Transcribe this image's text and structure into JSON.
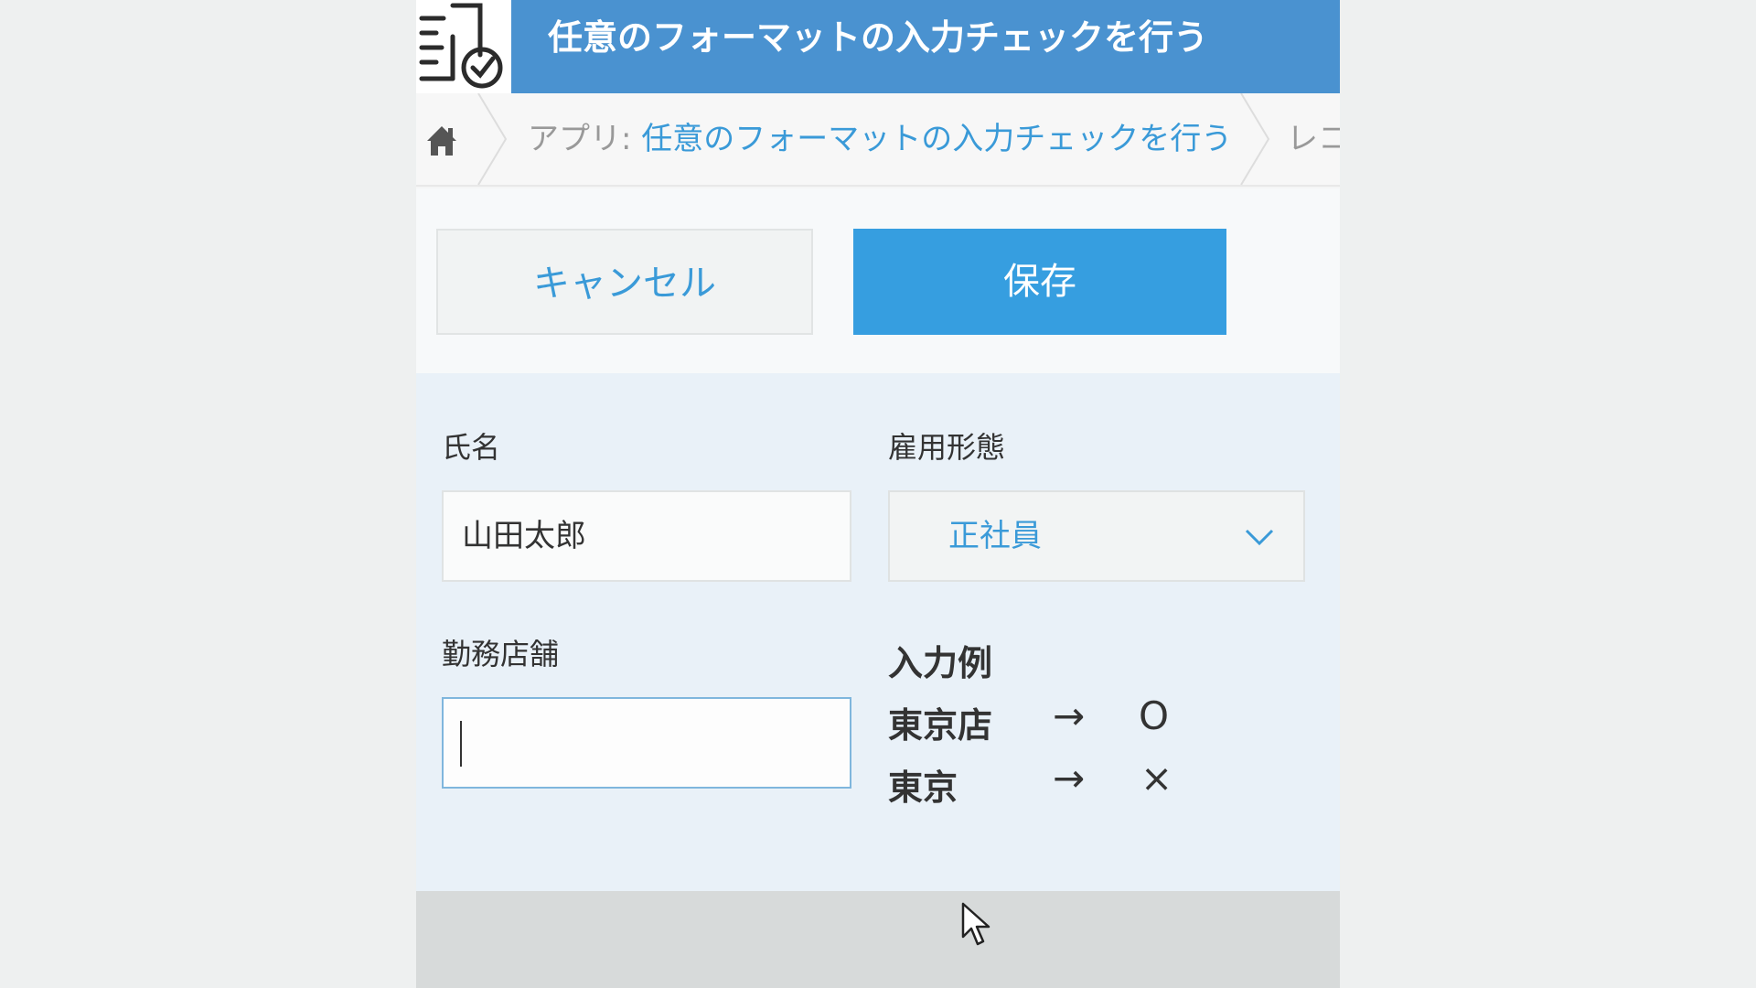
{
  "header": {
    "title": "任意のフォーマットの入力チェックを行う",
    "icon": "form-check-icon"
  },
  "breadcrumb": {
    "home_icon": "home-icon",
    "app_prefix": "アプリ: ",
    "app_name": "任意のフォーマットの入力チェックを行う",
    "next_partial": "レコ"
  },
  "toolbar": {
    "cancel_label": "キャンセル",
    "save_label": "保存"
  },
  "form": {
    "name_label": "氏名",
    "name_value": "山田太郎",
    "employment_label": "雇用形態",
    "employment_value": "正社員",
    "store_label": "勤務店舗",
    "store_value": ""
  },
  "example": {
    "heading": "入力例",
    "rows": [
      {
        "text": "東京店",
        "arrow": "→",
        "mark": "O"
      },
      {
        "text": "東京",
        "arrow": "→",
        "mark": "×"
      }
    ]
  },
  "colors": {
    "header_bg": "#4a92d0",
    "save_bg": "#369ee0",
    "link": "#3a9ad8",
    "form_bg": "#e9f1f8"
  }
}
